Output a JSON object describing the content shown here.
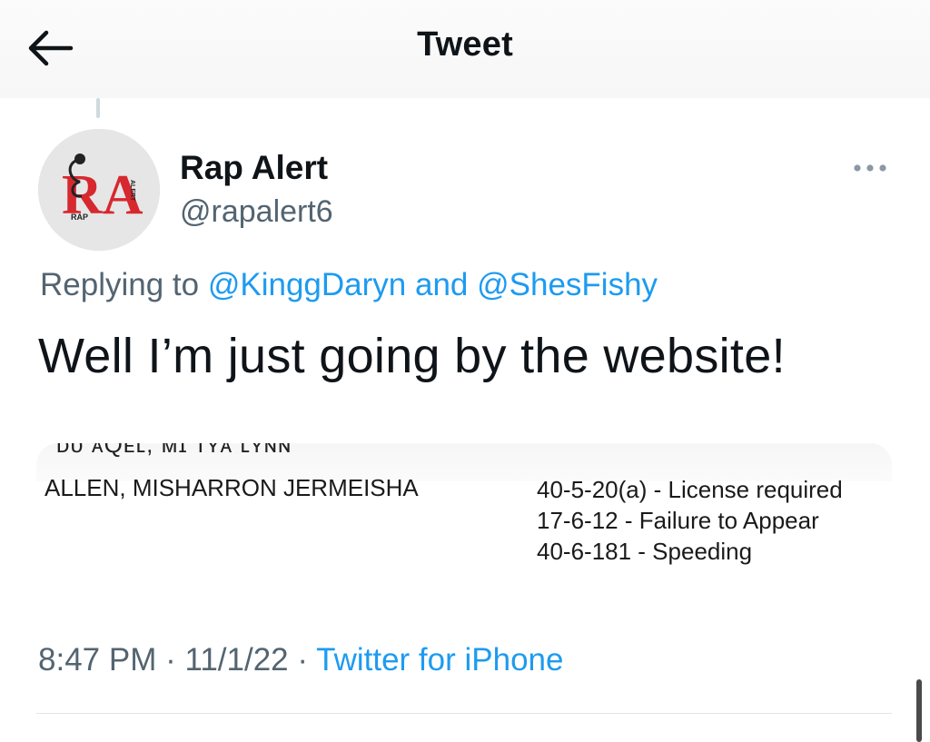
{
  "header": {
    "title": "Tweet",
    "back_icon": "arrow-left-icon"
  },
  "tweet": {
    "author": {
      "display_name": "Rap Alert",
      "handle": "@rapalert6",
      "avatar_text": "RA",
      "avatar_small_left": "RAP",
      "avatar_small_right": "ALERT"
    },
    "more_icon": "more-horizontal-icon",
    "reply": {
      "prefix": "Replying to ",
      "mention_1": "@KinggDaryn",
      "conjunction": " and ",
      "mention_2": "@ShesFishy"
    },
    "text": "Well I’m just going by the website!",
    "media": {
      "cut_off_row": "ᴅᴜ ᴀQᴇʟ, ᴍɪ ᴛʏᴀ ʟʏɴɴ",
      "name": "ALLEN, MISHARRON JERMEISHA",
      "charges": [
        "40-5-20(a) - License required",
        "17-6-12 - Failure to Appear",
        "40-6-181 - Speeding"
      ]
    },
    "meta": {
      "time": "8:47 PM",
      "separator": " · ",
      "date": "11/1/22",
      "source": "Twitter for iPhone"
    }
  },
  "colors": {
    "accent": "#1d9bf0",
    "secondary_text": "#536471",
    "primary_text": "#0f1419",
    "avatar_red": "#d7282f"
  }
}
